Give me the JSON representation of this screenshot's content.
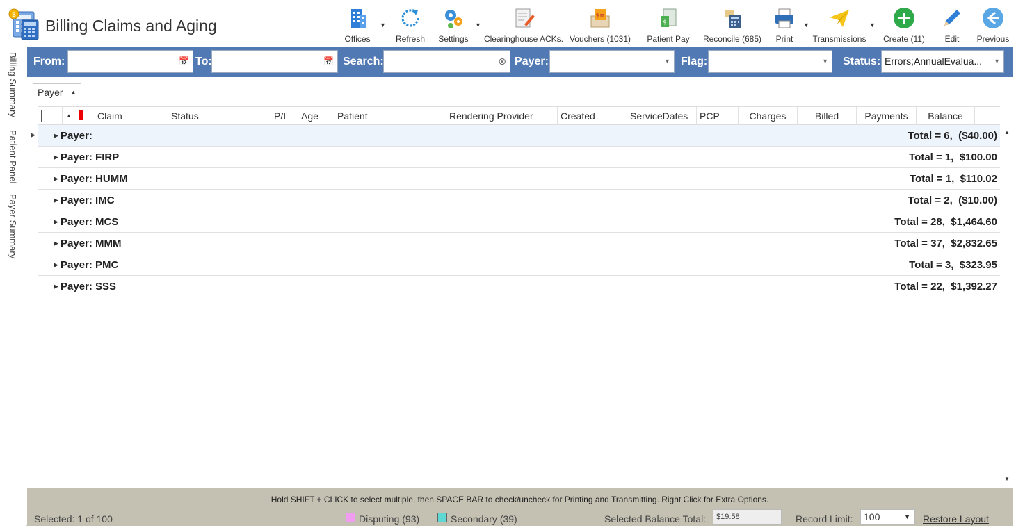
{
  "app": {
    "title": "Billing Claims and Aging"
  },
  "toolbar": {
    "offices": "Offices",
    "refresh": "Refresh",
    "settings": "Settings",
    "clearinghouse": "Clearinghouse ACKs.",
    "vouchers": "Vouchers (1031)",
    "patient_pay": "Patient Pay",
    "reconcile": "Reconcile (685)",
    "print": "Print",
    "transmissions": "Transmissions",
    "create": "Create (11)",
    "edit": "Edit",
    "previous": "Previous"
  },
  "side_tabs": [
    "Billing Summary",
    "Patient Panel",
    "Payer Summary"
  ],
  "filters": {
    "from_label": "From:",
    "from_value": "",
    "to_label": "To:",
    "to_value": "",
    "search_label": "Search:",
    "search_value": "",
    "payer_label": "Payer:",
    "payer_value": "",
    "flag_label": "Flag:",
    "flag_value": "",
    "status_label": "Status:",
    "status_value": "Errors;AnnualEvalua..."
  },
  "group_by": {
    "label": "Payer"
  },
  "grid": {
    "columns": [
      "Claim",
      "Status",
      "P/I",
      "Age",
      "Patient",
      "Rendering Provider",
      "Created",
      "ServiceDates",
      "PCP",
      "Charges",
      "Billed",
      "Payments",
      "Balance"
    ],
    "groups": [
      {
        "name": "Payer:",
        "total": "Total = 6,  ($40.00)"
      },
      {
        "name": "Payer: FIRP",
        "total": "Total = 1,  $100.00"
      },
      {
        "name": "Payer: HUMM",
        "total": "Total = 1,  $110.02"
      },
      {
        "name": "Payer: IMC",
        "total": "Total = 2,  ($10.00)"
      },
      {
        "name": "Payer: MCS",
        "total": "Total = 28,  $1,464.60"
      },
      {
        "name": "Payer: MMM",
        "total": "Total = 37,  $2,832.65"
      },
      {
        "name": "Payer: PMC",
        "total": "Total = 3,  $323.95"
      },
      {
        "name": "Payer: SSS",
        "total": "Total = 22,  $1,392.27"
      }
    ]
  },
  "footer": {
    "hint": "Hold SHIFT + CLICK to select multiple, then SPACE BAR to check/uncheck for Printing and Transmitting. Right Click for Extra Options.",
    "selected": "Selected: 1 of 100",
    "disputing": "Disputing (93)",
    "secondary": "Secondary (39)",
    "selected_balance_label": "Selected Balance Total:",
    "selected_balance_value": "$19.58",
    "record_limit_label": "Record Limit:",
    "record_limit_value": "100",
    "restore_layout": "Restore Layout"
  },
  "colors": {
    "filter_bar": "#5179b4",
    "footer_bg": "#c4c0b2",
    "disputing": "#f09cf0",
    "secondary": "#5fd7d2",
    "flag": "#e00000"
  }
}
